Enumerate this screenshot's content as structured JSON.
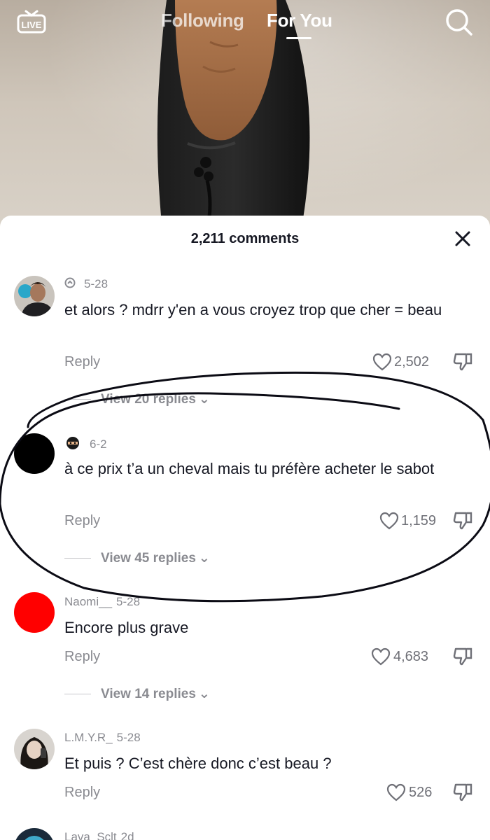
{
  "topnav": {
    "live_label": "LIVE",
    "tabs": [
      {
        "label": "Following",
        "active": false
      },
      {
        "label": "For You",
        "active": true
      }
    ]
  },
  "comments_sheet": {
    "title": "2,211 comments",
    "comments": [
      {
        "username": "",
        "flair_icon": "badge-icon",
        "date": "5-28",
        "text": "et alors ? mdrr y'en a vous croyez trop que cher = beau",
        "reply_label": "Reply",
        "likes": "2,502",
        "view_replies": "View 20 replies"
      },
      {
        "username": "",
        "flair_icon": "ninja-emoji",
        "date": "6-2",
        "text": "à ce prix t’a un cheval mais tu préfère acheter le sabot",
        "reply_label": "Reply",
        "likes": "1,159",
        "view_replies": "View 45 replies"
      },
      {
        "username": "Naomi__",
        "date": "5-28",
        "text": "Encore plus grave",
        "reply_label": "Reply",
        "likes": "4,683",
        "view_replies": "View 14 replies"
      },
      {
        "username": "L.M.Y.R_",
        "date": "5-28",
        "text": "Et puis ? C’est chère donc c’est beau ?",
        "reply_label": "Reply",
        "likes": "526"
      },
      {
        "username": "Lava_Sclt",
        "date": "2d"
      }
    ]
  },
  "colors": {
    "accent_red": "#ff0000",
    "text_primary": "#161823",
    "text_secondary": "#8a8b91"
  }
}
